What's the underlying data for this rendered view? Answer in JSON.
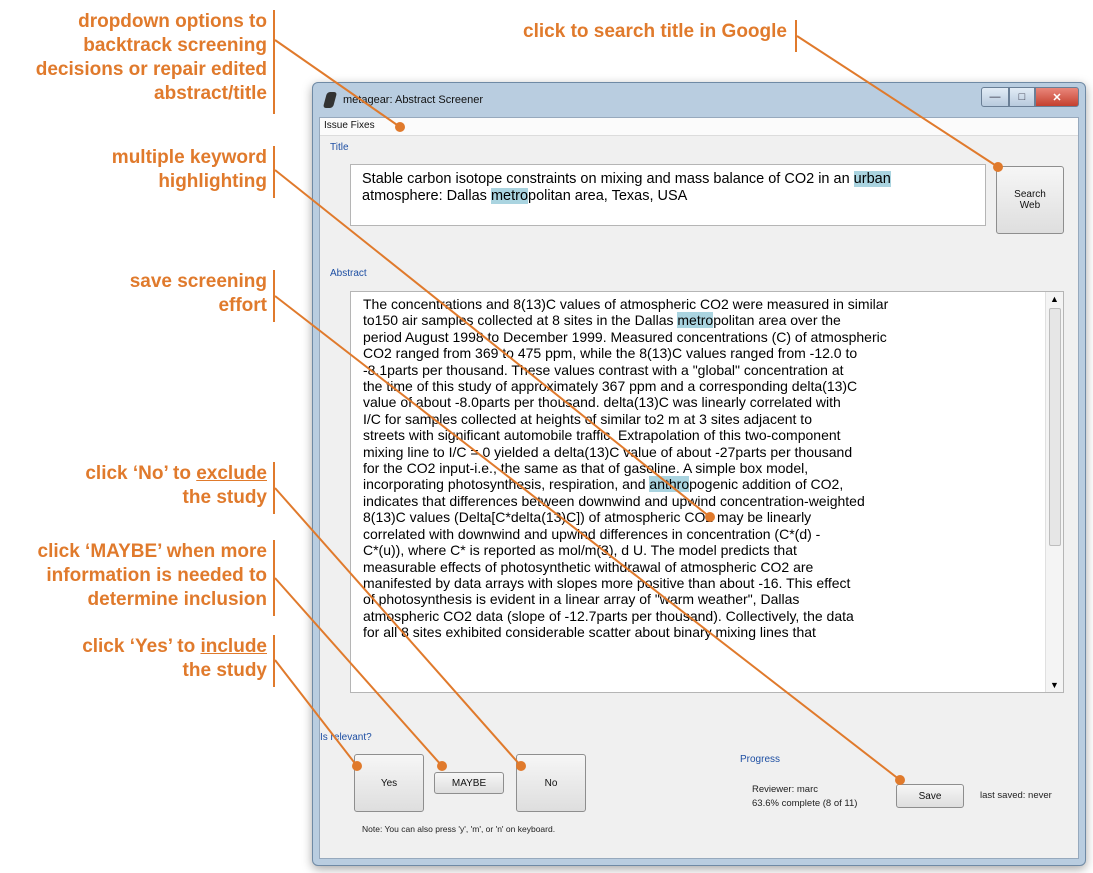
{
  "callouts": {
    "dropdown": [
      "dropdown options to",
      "backtrack screening",
      "decisions or repair edited",
      "abstract/title"
    ],
    "search": "click to search title in Google",
    "highlight": [
      "multiple keyword",
      "highlighting"
    ],
    "save": [
      "save screening",
      "effort"
    ],
    "no": {
      "pre": "click ‘No’ to ",
      "link": "exclude",
      "post": "the study"
    },
    "maybe": [
      "click ‘MAYBE’ when more",
      "information is needed to",
      "determine inclusion"
    ],
    "yes": {
      "pre": "click ‘Yes’ to ",
      "link": "include",
      "post": "the study"
    }
  },
  "window": {
    "title": "metagear: Abstract Screener",
    "menu": "Issue Fixes",
    "title_label": "Title",
    "title_text": {
      "part1": "Stable carbon isotope constraints on mixing and mass balance of CO2 in an ",
      "hl1": "urban",
      "part2": "atmosphere: Dallas ",
      "hl2": "metro",
      "part3": "politan area, Texas, USA"
    },
    "search_button": "Search\nWeb",
    "abstract_label": "Abstract",
    "abstract_lines": [
      {
        "a": "The concentrations and 8(13)C values of atmospheric CO2 were measured in similar"
      },
      {
        "a": "to150 air samples collected at 8 sites in the Dallas ",
        "h": "metro",
        "b": "politan area over the"
      },
      {
        "a": "period August 1998 to December 1999. Measured concentrations (C) of atmospheric"
      },
      {
        "a": "CO2 ranged from 369 to 475 ppm, while the 8(13)C values ranged from -12.0 to"
      },
      {
        "a": "-8.1parts per thousand. These values contrast with a \"global\" concentration at"
      },
      {
        "a": "the time of this study of approximately 367 ppm and a corresponding delta(13)C"
      },
      {
        "a": "value of about -8.0parts per thousand. delta(13)C was linearly correlated with"
      },
      {
        "a": "I/C for samples collected at heights of similar to2 m at 3 sites adjacent to"
      },
      {
        "a": "streets with significant automobile traffic. Extrapolation of this two-component"
      },
      {
        "a": "mixing line to I/C = 0 yielded a delta(13)C value of about -27parts per thousand"
      },
      {
        "a": "for the CO2 input-i.e., the same as that of gasoline. A simple box model,"
      },
      {
        "a": "incorporating photosynthesis, respiration, and ",
        "h": "anthro",
        "b": "pogenic addition of CO2,"
      },
      {
        "a": "indicates that differences between downwind and upwind concentration-weighted"
      },
      {
        "a": "8(13)C values (Delta[C*delta(13)C]) of atmospheric CO2 may be linearly"
      },
      {
        "a": "correlated with downwind and upwind differences in concentration (C*(d) -"
      },
      {
        "a": "C*(u)), where C* is reported as mol/m(3), d U. The model predicts that"
      },
      {
        "a": "measurable effects of photosynthetic withdrawal of atmospheric CO2 are"
      },
      {
        "a": "manifested by data arrays with slopes more positive than about -16. This effect"
      },
      {
        "a": "of photosynthesis is evident in a linear array of \"warm weather\", Dallas"
      },
      {
        "a": "atmospheric CO2 data (slope of -12.7parts per thousand). Collectively, the data"
      },
      {
        "a": "for all 8 sites exhibited considerable scatter about binary mixing lines that"
      }
    ],
    "relevant_label": "Is relevant?",
    "yes_button": "Yes",
    "maybe_button": "MAYBE",
    "no_button": "No",
    "note": "Note: You can also press 'y', 'm', or 'n' on keyboard.",
    "progress_label": "Progress",
    "reviewer": "Reviewer: marc",
    "complete": "63.6% complete (8 of 11)",
    "save_button": "Save",
    "last_saved": "last saved: never"
  },
  "colors": {
    "accent": "#e07a2c",
    "highlight": "#aad4e0",
    "label": "#1e4fa3"
  }
}
